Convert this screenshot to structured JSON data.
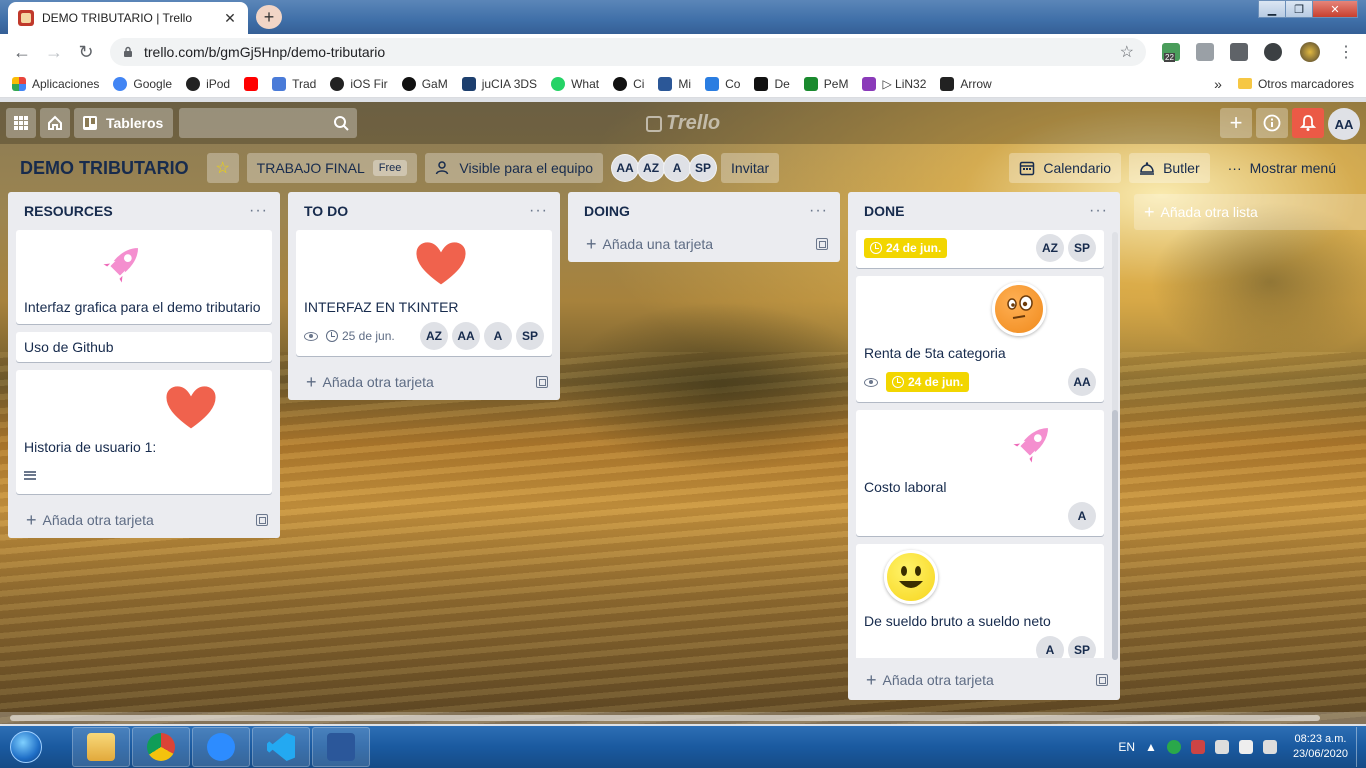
{
  "browser": {
    "tab_title": "DEMO TRIBUTARIO | Trello",
    "tab_close": "✕",
    "new_tab": "+",
    "url": "trello.com/b/gmGj5Hnp/demo-tributario",
    "ext_badge": "22",
    "bookmarks": [
      {
        "label": "Aplicaciones",
        "color": "#e8453c"
      },
      {
        "label": "Google",
        "color": "#4285f4"
      },
      {
        "label": "iPod",
        "color": "#222222"
      },
      {
        "label": "",
        "color": "#ff0000"
      },
      {
        "label": "Trad",
        "color": "#4a7bd8"
      },
      {
        "label": "iOS Fir",
        "color": "#222222"
      },
      {
        "label": "GaM",
        "color": "#111111"
      },
      {
        "label": "juCIA 3DS",
        "color": "#1d3f6e"
      },
      {
        "label": "What",
        "color": "#25d366"
      },
      {
        "label": "Ci",
        "color": "#111111"
      },
      {
        "label": "Mi",
        "color": "#2b5797"
      },
      {
        "label": "Co",
        "color": "#2a7de1"
      },
      {
        "label": "De",
        "color": "#111111"
      },
      {
        "label": "PeM",
        "color": "#1a8a2e"
      },
      {
        "label": "▷ LiN32",
        "color": "#8a3ab9"
      },
      {
        "label": "Arrow",
        "color": "#222222"
      }
    ],
    "bookmarks_more": "»",
    "other_bookmarks": "Otros marcadores"
  },
  "header": {
    "boards_label": "Tableros",
    "logo_text": "Trello",
    "user_initials": "AA"
  },
  "board": {
    "name": "DEMO TRIBUTARIO",
    "team_name": "TRABAJO FINAL",
    "team_plan": "Free",
    "visibility": "Visible para el equipo",
    "members": [
      "AA",
      "AZ",
      "A",
      "SP"
    ],
    "invite": "Invitar",
    "calendar": "Calendario",
    "butler": "Butler",
    "show_menu": "Mostrar menú",
    "add_list": "Añada otra lista"
  },
  "lists": {
    "resources": {
      "title": "RESOURCES",
      "cards": [
        "Interfaz grafica para el demo tributario",
        "Uso de Github",
        "Historia de usuario 1:"
      ],
      "add": "Añada otra tarjeta"
    },
    "todo": {
      "title": "TO DO",
      "card_title": "INTERFAZ EN TKINTER",
      "card_due": "25 de jun.",
      "card_members": [
        "AZ",
        "AA",
        "A",
        "SP"
      ],
      "add": "Añada otra tarjeta"
    },
    "doing": {
      "title": "DOING",
      "add": "Añada una tarjeta"
    },
    "done": {
      "title": "DONE",
      "card1_due": "24 de jun.",
      "card1_members": [
        "AZ",
        "SP"
      ],
      "card2_title": "Renta de 5ta categoria",
      "card2_due": "24 de jun.",
      "card2_members": [
        "AA"
      ],
      "card3_title": "Costo laboral",
      "card3_members": [
        "A"
      ],
      "card4_title": "De sueldo bruto a sueldo neto",
      "card4_members": [
        "A",
        "SP"
      ],
      "add": "Añada otra tarjeta"
    }
  },
  "taskbar": {
    "lang": "EN",
    "time": "08:23 a.m.",
    "date": "23/06/2020"
  }
}
